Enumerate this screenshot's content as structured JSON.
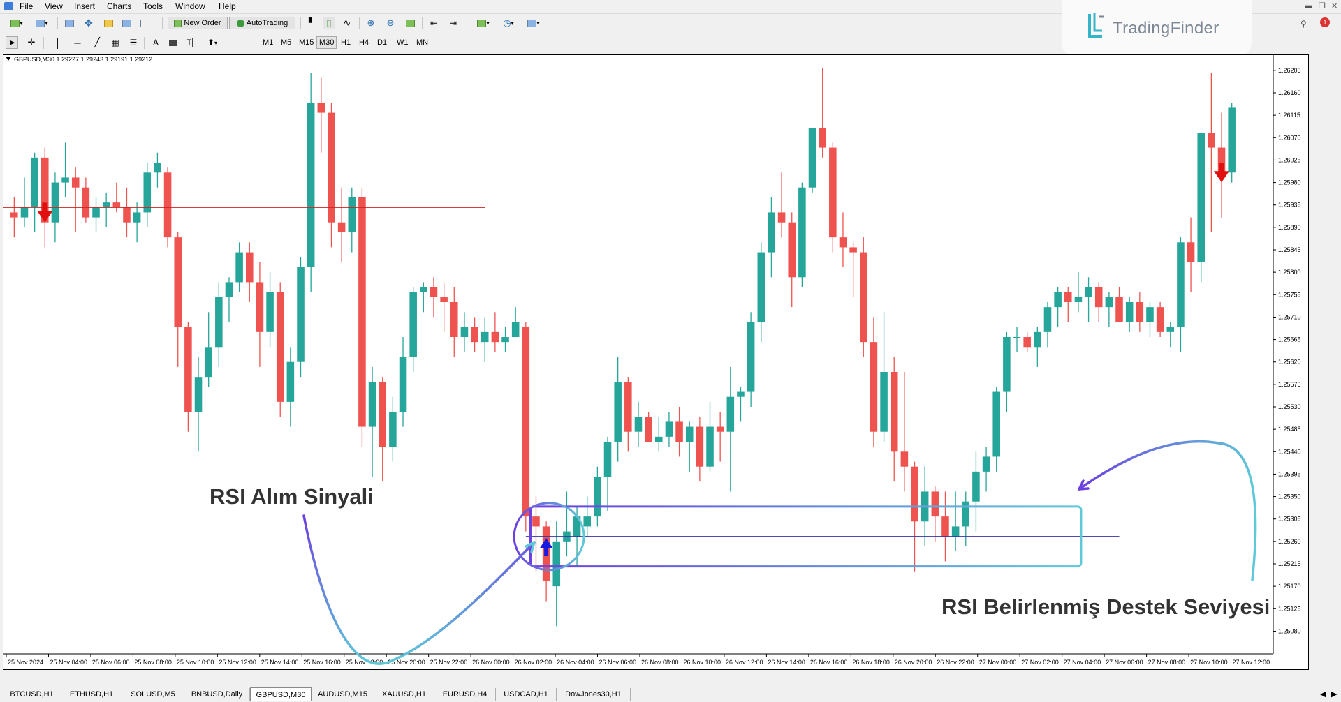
{
  "menu": {
    "items": [
      "File",
      "View",
      "Insert",
      "Charts",
      "Tools",
      "Window",
      "Help"
    ]
  },
  "toolbar": {
    "new_order_label": "New Order",
    "autotrading_label": "AutoTrading",
    "timeframes": [
      "M1",
      "M5",
      "M15",
      "M30",
      "H1",
      "H4",
      "D1",
      "W1",
      "MN"
    ],
    "active_timeframe": "M30"
  },
  "logo": {
    "text": "TradingFinder",
    "color": "#35b4c8"
  },
  "chart": {
    "symbol_info": "GBPUSD,M30  1.29227 1.29243 1.29191 1.29212"
  },
  "annotations": {
    "buy_signal": "RSI Alım Sinyali",
    "support_level": "RSI Belirlenmiş Destek Seviyesi"
  },
  "tabs": {
    "items": [
      "BTCUSD,H1",
      "ETHUSD,H1",
      "SOLUSD,M5",
      "BNBUSD,Daily",
      "GBPUSD,M30",
      "AUDUSD,M15",
      "XAUUSD,H1",
      "EURUSD,H4",
      "USDCAD,H1",
      "DowJones30,H1"
    ],
    "active": "GBPUSD,M30"
  },
  "colors": {
    "bull": "#26a69a",
    "bear": "#ef5350",
    "level_line": "#cc2222",
    "support_line": "#3333aa",
    "zone_stroke_start": "#6c3fe0",
    "zone_stroke_end": "#5ec9d8"
  },
  "chart_data": {
    "type": "candlestick",
    "y_ticks": [
      "1.26205",
      "1.26160",
      "1.26115",
      "1.26070",
      "1.26025",
      "1.25980",
      "1.25935",
      "1.25890",
      "1.25845",
      "1.25800",
      "1.25755",
      "1.25710",
      "1.25665",
      "1.25620",
      "1.25575",
      "1.25530",
      "1.25485",
      "1.25440",
      "1.25395",
      "1.25350",
      "1.25305",
      "1.25260",
      "1.25215",
      "1.25170",
      "1.25125",
      "1.25080"
    ],
    "ylim": [
      1.2504,
      1.2623
    ],
    "x_ticks": [
      "25 Nov 2024",
      "25 Nov 04:00",
      "25 Nov 06:00",
      "25 Nov 08:00",
      "25 Nov 10:00",
      "25 Nov 12:00",
      "25 Nov 14:00",
      "25 Nov 16:00",
      "25 Nov 18:00",
      "25 Nov 20:00",
      "25 Nov 22:00",
      "26 Nov 00:00",
      "26 Nov 02:00",
      "26 Nov 04:00",
      "26 Nov 06:00",
      "26 Nov 08:00",
      "26 Nov 10:00",
      "26 Nov 12:00",
      "26 Nov 14:00",
      "26 Nov 16:00",
      "26 Nov 18:00",
      "26 Nov 20:00",
      "26 Nov 22:00",
      "27 Nov 00:00",
      "27 Nov 02:00",
      "27 Nov 04:00",
      "27 Nov 06:00",
      "27 Nov 08:00",
      "27 Nov 10:00",
      "27 Nov 12:00"
    ],
    "candles": [
      [
        1.2592,
        1.2595,
        1.2587,
        1.2591
      ],
      [
        1.2591,
        1.2599,
        1.2589,
        1.2593
      ],
      [
        1.2593,
        1.2604,
        1.2588,
        1.2603
      ],
      [
        1.2603,
        1.2605,
        1.2585,
        1.259
      ],
      [
        1.259,
        1.26,
        1.2586,
        1.2598
      ],
      [
        1.2598,
        1.2606,
        1.2595,
        1.2599
      ],
      [
        1.2599,
        1.2601,
        1.2588,
        1.2597
      ],
      [
        1.2597,
        1.2599,
        1.259,
        1.2591
      ],
      [
        1.2591,
        1.2595,
        1.2588,
        1.2593
      ],
      [
        1.2593,
        1.2596,
        1.2589,
        1.2594
      ],
      [
        1.2594,
        1.2598,
        1.2592,
        1.2593
      ],
      [
        1.2593,
        1.2597,
        1.2587,
        1.259
      ],
      [
        1.259,
        1.2594,
        1.2586,
        1.2592
      ],
      [
        1.2592,
        1.2602,
        1.2589,
        1.26
      ],
      [
        1.26,
        1.2604,
        1.2597,
        1.2602
      ],
      [
        1.26,
        1.2601,
        1.2585,
        1.2587
      ],
      [
        1.2587,
        1.2588,
        1.2561,
        1.2569
      ],
      [
        1.2569,
        1.257,
        1.2548,
        1.2552
      ],
      [
        1.2552,
        1.2563,
        1.2544,
        1.2559
      ],
      [
        1.2559,
        1.2572,
        1.2557,
        1.2565
      ],
      [
        1.2565,
        1.2578,
        1.2561,
        1.2575
      ],
      [
        1.2575,
        1.2579,
        1.257,
        1.2578
      ],
      [
        1.2578,
        1.2586,
        1.2576,
        1.2584
      ],
      [
        1.2584,
        1.2586,
        1.2574,
        1.2578
      ],
      [
        1.2578,
        1.2582,
        1.2561,
        1.2568
      ],
      [
        1.2568,
        1.258,
        1.2565,
        1.2576
      ],
      [
        1.2576,
        1.2578,
        1.2551,
        1.2554
      ],
      [
        1.2554,
        1.2565,
        1.2549,
        1.2562
      ],
      [
        1.2562,
        1.2583,
        1.2559,
        1.2581
      ],
      [
        1.2581,
        1.262,
        1.2576,
        1.2614
      ],
      [
        1.2614,
        1.2619,
        1.2604,
        1.2612
      ],
      [
        1.2612,
        1.2614,
        1.2585,
        1.259
      ],
      [
        1.259,
        1.2597,
        1.2582,
        1.2588
      ],
      [
        1.2588,
        1.2597,
        1.2584,
        1.2595
      ],
      [
        1.2595,
        1.2597,
        1.2545,
        1.2549
      ],
      [
        1.2549,
        1.2561,
        1.2539,
        1.2558
      ],
      [
        1.2558,
        1.2559,
        1.2538,
        1.2545
      ],
      [
        1.2545,
        1.2555,
        1.2542,
        1.2552
      ],
      [
        1.2552,
        1.2567,
        1.2549,
        1.2563
      ],
      [
        1.2563,
        1.2577,
        1.256,
        1.2576
      ],
      [
        1.2576,
        1.2578,
        1.2572,
        1.2577
      ],
      [
        1.2577,
        1.2579,
        1.2571,
        1.2575
      ],
      [
        1.2575,
        1.2578,
        1.2568,
        1.2574
      ],
      [
        1.2574,
        1.2577,
        1.2563,
        1.2567
      ],
      [
        1.2567,
        1.2572,
        1.2564,
        1.2569
      ],
      [
        1.2569,
        1.2571,
        1.2564,
        1.2566
      ],
      [
        1.2566,
        1.2571,
        1.2562,
        1.2568
      ],
      [
        1.2568,
        1.2572,
        1.2564,
        1.2566
      ],
      [
        1.2566,
        1.2569,
        1.2564,
        1.2567
      ],
      [
        1.2567,
        1.2573,
        1.2567,
        1.257
      ],
      [
        1.2569,
        1.257,
        1.2528,
        1.2531
      ],
      [
        1.2531,
        1.2535,
        1.252,
        1.2529
      ],
      [
        1.2529,
        1.253,
        1.2514,
        1.2518
      ],
      [
        1.2517,
        1.253,
        1.2509,
        1.2526
      ],
      [
        1.2526,
        1.2536,
        1.2523,
        1.2528
      ],
      [
        1.2527,
        1.2533,
        1.2521,
        1.2531
      ],
      [
        1.2529,
        1.2535,
        1.2527,
        1.2531
      ],
      [
        1.2531,
        1.2541,
        1.2529,
        1.2539
      ],
      [
        1.2539,
        1.2547,
        1.2532,
        1.2546
      ],
      [
        1.2546,
        1.2563,
        1.2542,
        1.2558
      ],
      [
        1.2558,
        1.2559,
        1.2544,
        1.2548
      ],
      [
        1.2548,
        1.2554,
        1.2545,
        1.2551
      ],
      [
        1.2551,
        1.2552,
        1.2546,
        1.2546
      ],
      [
        1.2546,
        1.2551,
        1.2544,
        1.2547
      ],
      [
        1.2547,
        1.2552,
        1.2545,
        1.255
      ],
      [
        1.255,
        1.2553,
        1.2543,
        1.2546
      ],
      [
        1.2546,
        1.255,
        1.254,
        1.2549
      ],
      [
        1.2549,
        1.2551,
        1.2538,
        1.2541
      ],
      [
        1.2541,
        1.2554,
        1.254,
        1.2549
      ],
      [
        1.2549,
        1.2552,
        1.2542,
        1.2548
      ],
      [
        1.2548,
        1.2561,
        1.2536,
        1.2555
      ],
      [
        1.2555,
        1.2557,
        1.255,
        1.2556
      ],
      [
        1.2556,
        1.2572,
        1.2553,
        1.257
      ],
      [
        1.257,
        1.2586,
        1.2566,
        1.2584
      ],
      [
        1.2584,
        1.2595,
        1.2579,
        1.2592
      ],
      [
        1.2592,
        1.26,
        1.2587,
        1.259
      ],
      [
        1.259,
        1.2592,
        1.2573,
        1.2579
      ],
      [
        1.2579,
        1.2598,
        1.2577,
        1.2597
      ],
      [
        1.2597,
        1.2609,
        1.2596,
        1.2609
      ],
      [
        1.2609,
        1.2621,
        1.2603,
        1.2605
      ],
      [
        1.2605,
        1.2606,
        1.2584,
        1.2587
      ],
      [
        1.2587,
        1.2592,
        1.2581,
        1.2585
      ],
      [
        1.2585,
        1.2586,
        1.2575,
        1.2584
      ],
      [
        1.2584,
        1.2587,
        1.2563,
        1.2566
      ],
      [
        1.2566,
        1.2571,
        1.2545,
        1.2548
      ],
      [
        1.2548,
        1.2572,
        1.2546,
        1.256
      ],
      [
        1.256,
        1.2563,
        1.2538,
        1.2544
      ],
      [
        1.2544,
        1.256,
        1.2536,
        1.2541
      ],
      [
        1.2541,
        1.2542,
        1.252,
        1.253
      ],
      [
        1.253,
        1.2541,
        1.2525,
        1.2536
      ],
      [
        1.2536,
        1.2537,
        1.2526,
        1.2531
      ],
      [
        1.2531,
        1.2536,
        1.2522,
        1.2527
      ],
      [
        1.2527,
        1.2536,
        1.2524,
        1.2529
      ],
      [
        1.2529,
        1.2536,
        1.2525,
        1.2534
      ],
      [
        1.2534,
        1.2544,
        1.2528,
        1.254
      ],
      [
        1.254,
        1.2545,
        1.2536,
        1.2543
      ],
      [
        1.2543,
        1.2557,
        1.254,
        1.2556
      ],
      [
        1.2556,
        1.2568,
        1.2552,
        1.2567
      ],
      [
        1.2567,
        1.2569,
        1.2564,
        1.2567
      ],
      [
        1.2567,
        1.2568,
        1.2564,
        1.2565
      ],
      [
        1.2565,
        1.2569,
        1.2561,
        1.2568
      ],
      [
        1.2568,
        1.2574,
        1.2565,
        1.2573
      ],
      [
        1.2573,
        1.2577,
        1.2569,
        1.2576
      ],
      [
        1.2576,
        1.2577,
        1.257,
        1.2574
      ],
      [
        1.2574,
        1.258,
        1.2572,
        1.2575
      ],
      [
        1.2575,
        1.2579,
        1.257,
        1.2577
      ],
      [
        1.2577,
        1.2578,
        1.257,
        1.2573
      ],
      [
        1.2573,
        1.2576,
        1.2569,
        1.2575
      ],
      [
        1.2575,
        1.2577,
        1.257,
        1.257
      ],
      [
        1.257,
        1.2575,
        1.2568,
        1.2574
      ],
      [
        1.2574,
        1.2576,
        1.2568,
        1.257
      ],
      [
        1.257,
        1.2574,
        1.2567,
        1.2573
      ],
      [
        1.2573,
        1.2574,
        1.2567,
        1.2568
      ],
      [
        1.2568,
        1.257,
        1.2565,
        1.2569
      ],
      [
        1.2569,
        1.2587,
        1.2564,
        1.2586
      ],
      [
        1.2586,
        1.2591,
        1.2576,
        1.2582
      ],
      [
        1.2582,
        1.2602,
        1.2578,
        1.2608
      ],
      [
        1.2608,
        1.262,
        1.2588,
        1.2605
      ],
      [
        1.2605,
        1.2612,
        1.2591,
        1.26
      ],
      [
        1.26,
        1.2614,
        1.2598,
        1.2613
      ]
    ],
    "buy_signal_index": 52,
    "sell_signal_indices": [
      3,
      118
    ],
    "resistance_level": 1.2593,
    "support_level": 1.2527,
    "support_zone": [
      1.2521,
      1.2533
    ]
  }
}
